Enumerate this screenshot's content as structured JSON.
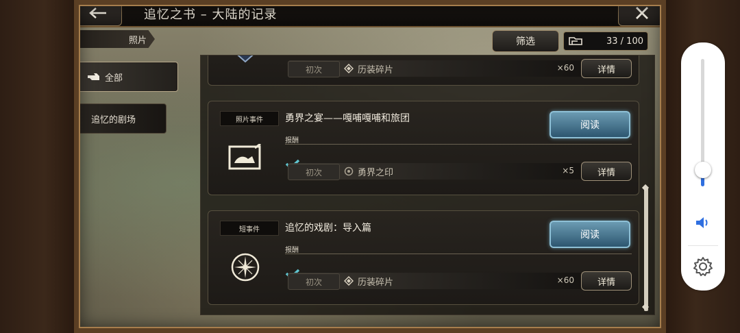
{
  "header": {
    "title": "追忆之书 – 大陆的记录"
  },
  "category": {
    "label": "照片"
  },
  "filter": {
    "label": "筛选"
  },
  "counter": {
    "value": "33 / 100"
  },
  "tabs": [
    {
      "label": "全部"
    },
    {
      "label": "追忆的剧场"
    }
  ],
  "cards": [
    {
      "reward": {
        "first": "初次",
        "item": "历装碎片",
        "qty": "×60",
        "detail": "详情"
      }
    },
    {
      "badge": "照片事件",
      "title": "勇界之宴——嘎哺嘎哺和旅团",
      "read": "阅读",
      "reward_label": "报酬",
      "reward": {
        "first": "初次",
        "item": "勇界之印",
        "qty": "×5",
        "detail": "详情"
      }
    },
    {
      "badge": "短事件",
      "title": "追忆的戏剧：导入篇",
      "read": "阅读",
      "reward_label": "报酬",
      "reward": {
        "first": "初次",
        "item": "历装碎片",
        "qty": "×60",
        "detail": "详情"
      }
    }
  ],
  "volume": {
    "level": 0.13
  },
  "colors": {
    "read_button": "#4f86a3",
    "volume_accent": "#2f6fe0"
  }
}
